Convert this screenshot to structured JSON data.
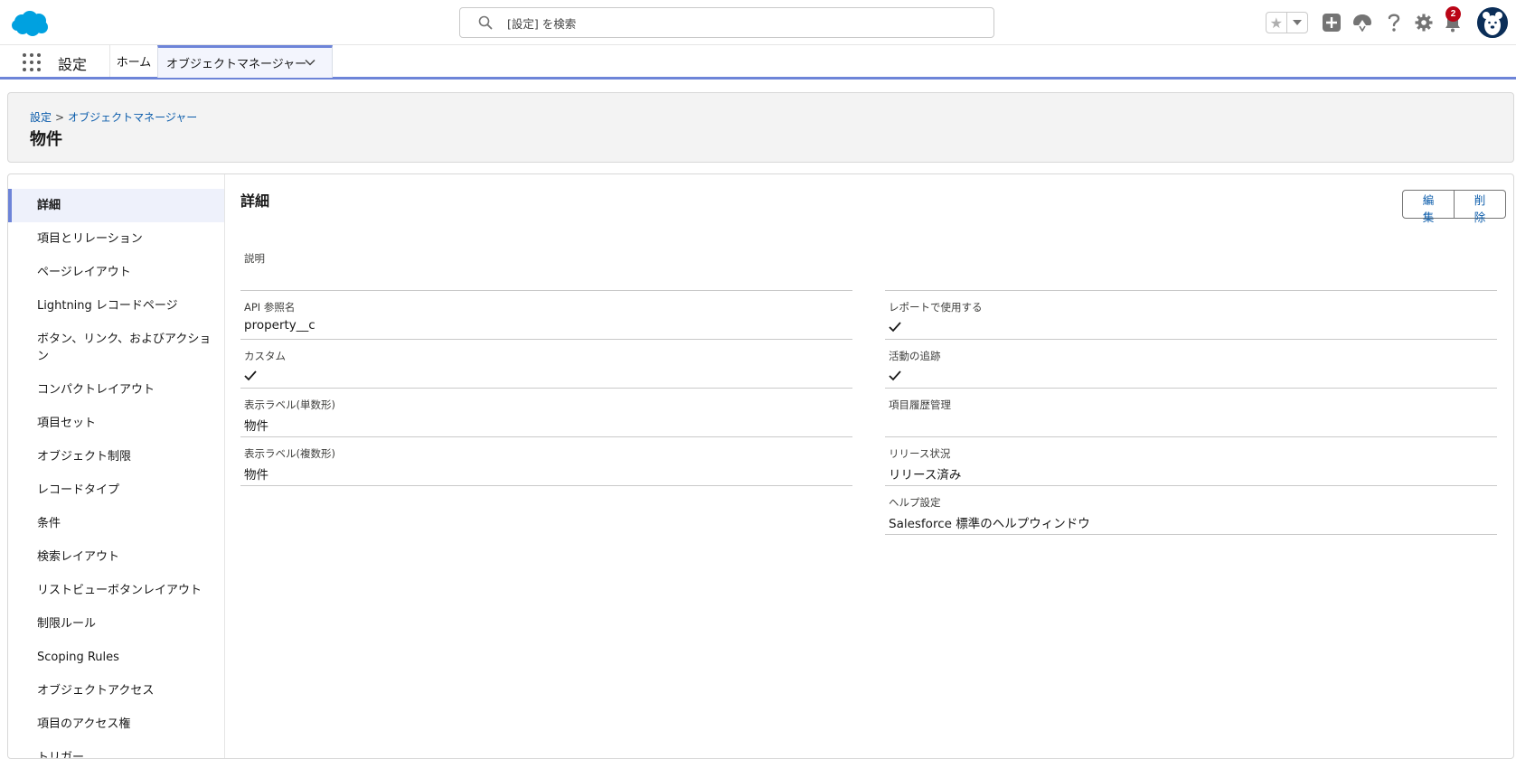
{
  "header": {
    "search_placeholder": "[設定] を検索",
    "notification_count": "2"
  },
  "nav": {
    "app_name": "設定",
    "tabs": [
      {
        "label": "ホーム"
      },
      {
        "label": "オブジェクトマネージャー"
      }
    ]
  },
  "page": {
    "breadcrumb": [
      "設定",
      "オブジェクトマネージャー"
    ],
    "breadcrumb_sep": ">",
    "title": "物件"
  },
  "sidebar": {
    "items": [
      {
        "label": "詳細",
        "active": true
      },
      {
        "label": "項目とリレーション"
      },
      {
        "label": "ページレイアウト"
      },
      {
        "label": "Lightning レコードページ"
      },
      {
        "label": "ボタン、リンク、およびアクション"
      },
      {
        "label": "コンパクトレイアウト"
      },
      {
        "label": "項目セット"
      },
      {
        "label": "オブジェクト制限"
      },
      {
        "label": "レコードタイプ"
      },
      {
        "label": "条件"
      },
      {
        "label": "検索レイアウト"
      },
      {
        "label": "リストビューボタンレイアウト"
      },
      {
        "label": "制限ルール"
      },
      {
        "label": "Scoping Rules"
      },
      {
        "label": "オブジェクトアクセス"
      },
      {
        "label": "項目のアクセス権"
      },
      {
        "label": "トリガー"
      }
    ]
  },
  "detail": {
    "title": "詳細",
    "edit_label": "編集",
    "delete_label": "削除",
    "left_fields": [
      {
        "label": "説明",
        "value": ""
      },
      {
        "label": "API 参照名",
        "value": "property__c"
      },
      {
        "label": "カスタム",
        "checked": true
      },
      {
        "label": "表示ラベル(単数形)",
        "value": "物件"
      },
      {
        "label": "表示ラベル(複数形)",
        "value": "物件"
      }
    ],
    "right_fields": [
      {
        "label": "",
        "value": ""
      },
      {
        "label": "レポートで使用する",
        "checked": true
      },
      {
        "label": "活動の追跡",
        "checked": true
      },
      {
        "label": "項目履歴管理",
        "value": ""
      },
      {
        "label": "リリース状況",
        "value": "リリース済み"
      },
      {
        "label": "ヘルプ設定",
        "value": "Salesforce 標準のヘルプウィンドウ"
      }
    ]
  },
  "colors": {
    "brand": "#00a1e0",
    "accent": "#6d84d8",
    "link": "#0b5cab",
    "badge": "#ba0517"
  }
}
